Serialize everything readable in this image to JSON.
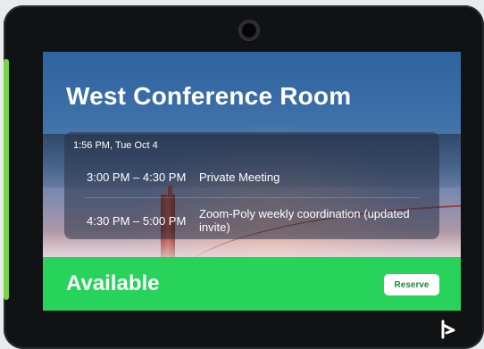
{
  "room": {
    "title": "West Conference Room"
  },
  "clock": {
    "datetime": "1:56 PM, Tue Oct 4"
  },
  "schedule": [
    {
      "time": "3:00 PM – 4:30 PM",
      "subject": "Private Meeting"
    },
    {
      "time": "4:30 PM – 5:00 PM",
      "subject": "Zoom-Poly weekly coordination (updated invite)"
    }
  ],
  "status": {
    "label": "Available",
    "color": "#27d35a"
  },
  "actions": {
    "reserve_label": "Reserve"
  },
  "icons": {
    "logo": "poly-logo-icon",
    "camera": "camera-icon"
  }
}
